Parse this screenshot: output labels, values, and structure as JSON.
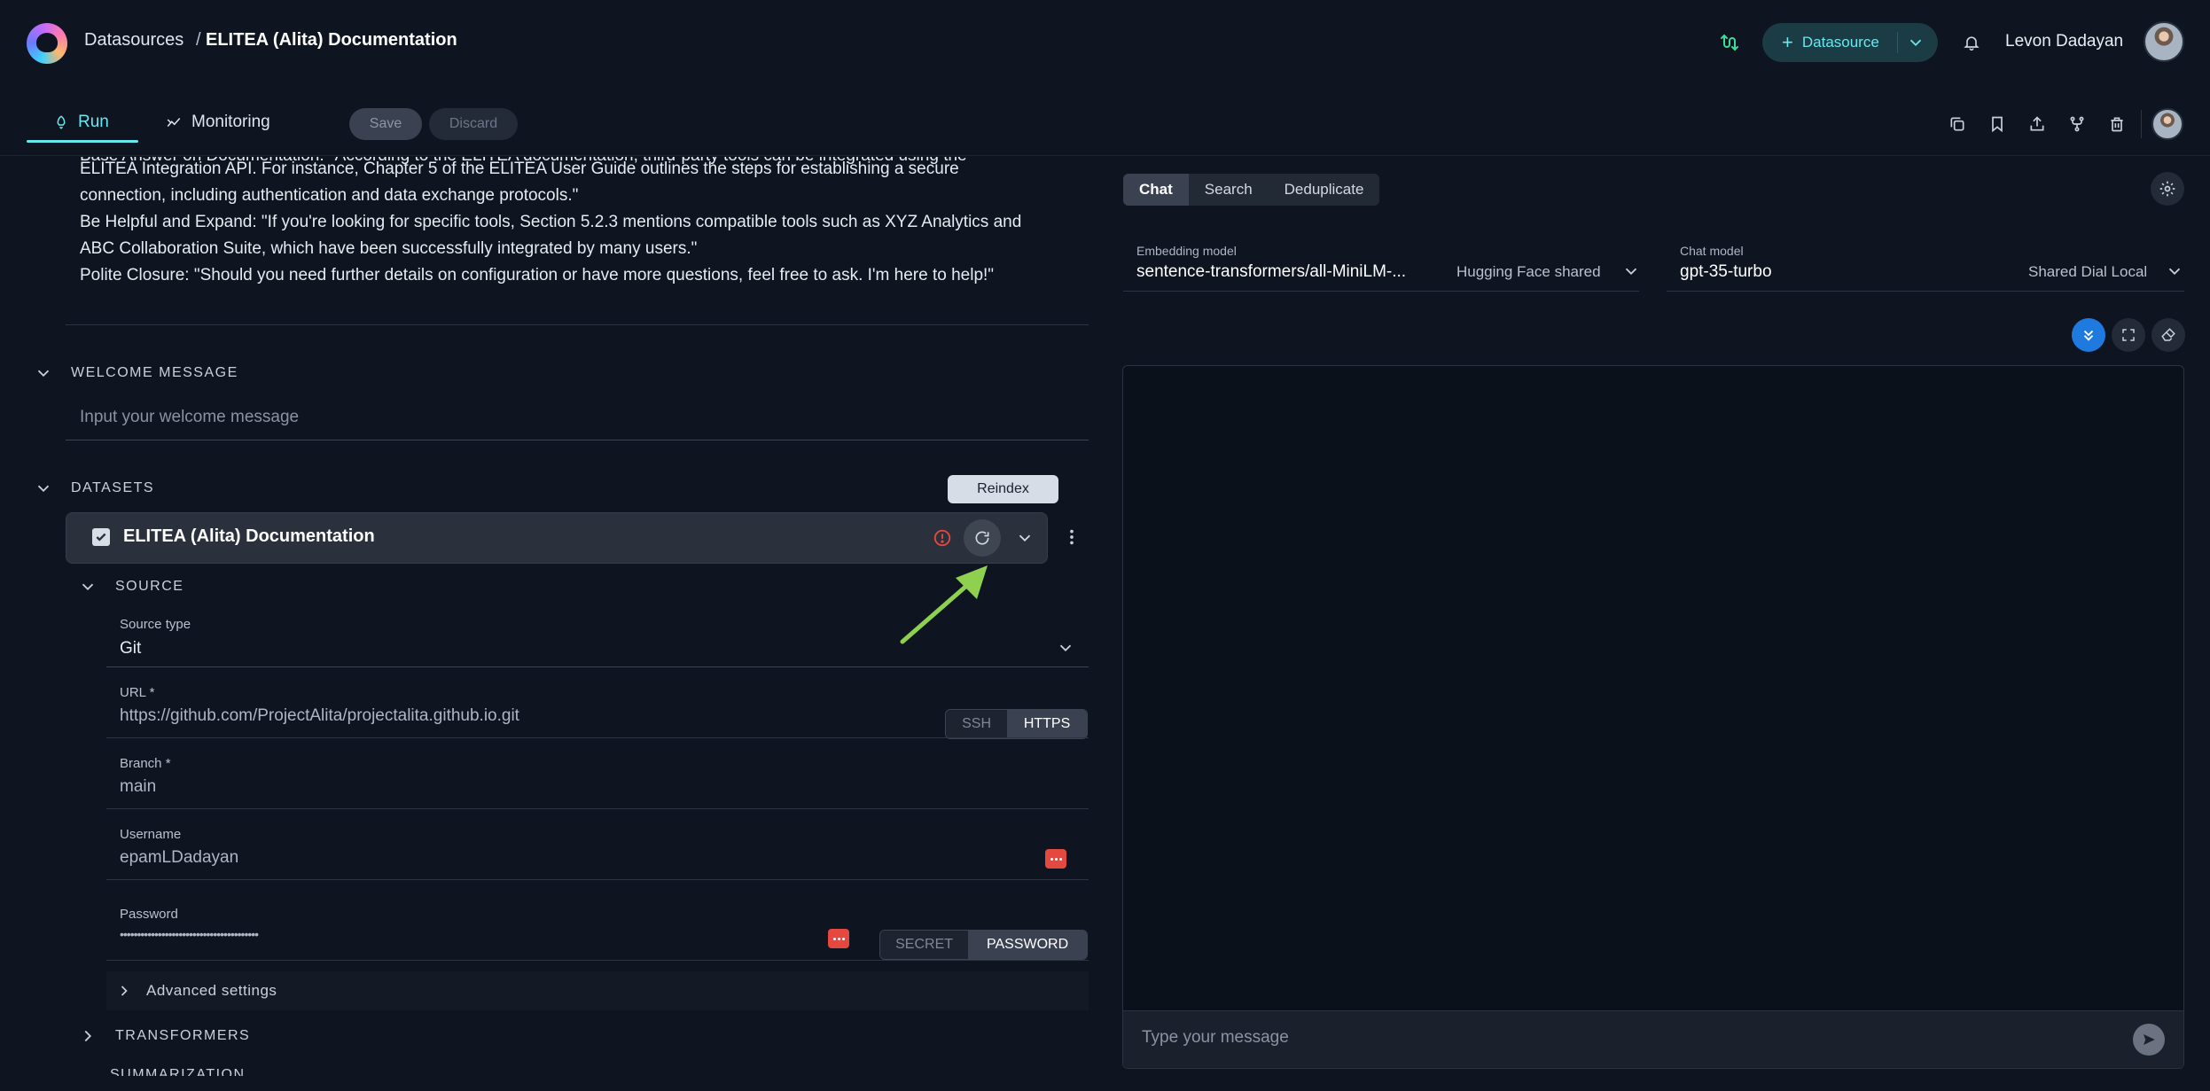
{
  "breadcrumb": {
    "parent": "Datasources",
    "separator": "/",
    "current": "ELITEA (Alita) Documentation"
  },
  "header": {
    "add_button_label": "Datasource",
    "user_name": "Levon Dadayan"
  },
  "tabs": [
    {
      "label": "Run",
      "active": true
    },
    {
      "label": "Monitoring",
      "active": false
    }
  ],
  "actions": {
    "save_label": "Save",
    "discard_label": "Discard"
  },
  "toolbar_icons": [
    "duplicate-icon",
    "bookmark-icon",
    "export-icon",
    "fork-icon",
    "delete-icon"
  ],
  "context": {
    "cut_line": "Base Answer on Documentation: \"According to the ELITEA documentation, third-party tools can be integrated using the",
    "lines": [
      "ELITEA Integration API. For instance, Chapter 5 of the ELITEA User Guide outlines the steps for establishing a secure",
      "connection, including authentication and data exchange protocols.\"",
      "Be Helpful and Expand: \"If you're looking for specific tools, Section 5.2.3 mentions compatible tools such as XYZ Analytics and",
      "ABC Collaboration Suite, which have been successfully integrated by many users.\"",
      "Polite Closure: \"Should you need further details on configuration or have more questions, feel free to ask. I'm here to help!\""
    ]
  },
  "welcome": {
    "section_title": "WELCOME MESSAGE",
    "placeholder": "Input your welcome message"
  },
  "datasets": {
    "section_title": "DATASETS",
    "tooltip": "Reindex",
    "dataset_name": "ELITEA (Alita) Documentation",
    "source_section": "SOURCE",
    "source_type_label": "Source type",
    "source_type_value": "Git",
    "url_label": "URL *",
    "url_value": "https://github.com/ProjectAlita/projectalita.github.io.git",
    "url_toggle": [
      "SSH",
      "HTTPS"
    ],
    "branch_label": "Branch *",
    "branch_value": "main",
    "username_label": "Username",
    "username_value": "epamLDadayan",
    "password_label": "Password",
    "password_value": "••••••••••••••••••••••••••••••••••••••••",
    "password_toggle": [
      "SECRET",
      "PASSWORD"
    ],
    "advanced_label": "Advanced settings",
    "transformers_section": "TRANSFORMERS",
    "next_section_cut": "SUMMARIZATION"
  },
  "right": {
    "segments": [
      "Chat",
      "Search",
      "Deduplicate"
    ],
    "embedding_label": "Embedding model",
    "embedding_value": "sentence-transformers/all-MiniLM-...",
    "embedding_tag": "Hugging Face shared",
    "chat_label": "Chat model",
    "chat_value": "gpt-35-turbo",
    "chat_tag": "Shared Dial Local",
    "message_placeholder": "Type your message"
  },
  "colors": {
    "accent": "#6ae6ee",
    "primary_blue": "#1f7ae0",
    "arrow_green": "#8fd14f",
    "error_red": "#e5483f"
  }
}
